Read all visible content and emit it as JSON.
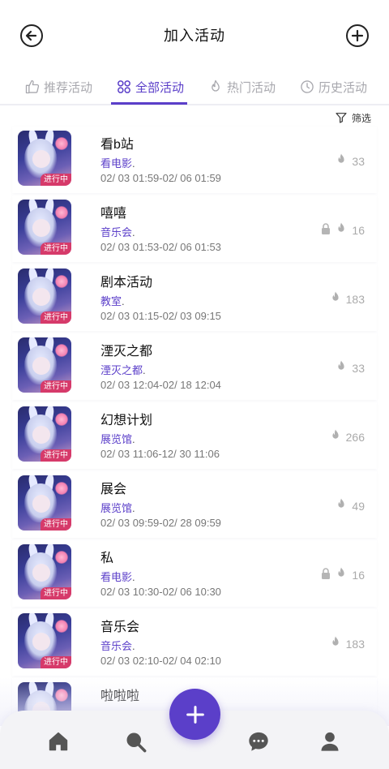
{
  "header": {
    "title": "加入活动"
  },
  "tabs": [
    {
      "label": "推荐活动",
      "icon": "thumb-up-icon"
    },
    {
      "label": "全部活动",
      "icon": "grid-icon",
      "active": true
    },
    {
      "label": "热门活动",
      "icon": "flame-icon"
    },
    {
      "label": "历史活动",
      "icon": "clock-icon"
    }
  ],
  "filter": {
    "label": "筛选"
  },
  "status_badge": "进行中",
  "items": [
    {
      "title": "看b站",
      "type": "看电影",
      "dot": ".",
      "time": "02/ 03  01:59-02/ 06  01:59",
      "count": "33",
      "locked": false
    },
    {
      "title": "嘻嘻",
      "type": "音乐会",
      "dot": ".",
      "time": "02/ 03  01:53-02/ 06  01:53",
      "count": "16",
      "locked": true
    },
    {
      "title": "剧本活动",
      "type": "教室",
      "dot": ".",
      "time": "02/ 03  01:15-02/ 03  09:15",
      "count": "183",
      "locked": false
    },
    {
      "title": "湮灭之都",
      "type": "湮灭之都",
      "dot": ".",
      "time": "02/ 03  12:04-02/ 18  12:04",
      "count": "33",
      "locked": false
    },
    {
      "title": "幻想计划",
      "type": "展览馆",
      "dot": ".",
      "time": "02/ 03  11:06-12/ 30  11:06",
      "count": "266",
      "locked": false
    },
    {
      "title": "展会",
      "type": "展览馆",
      "dot": ".",
      "time": "02/ 03  09:59-02/ 28  09:59",
      "count": "49",
      "locked": false
    },
    {
      "title": "私",
      "type": "看电影",
      "dot": ".",
      "time": "02/ 03  10:30-02/ 06  10:30",
      "count": "16",
      "locked": true
    },
    {
      "title": "音乐会",
      "type": "音乐会",
      "dot": ".",
      "time": "02/ 03  02:10-02/ 04  02:10",
      "count": "183",
      "locked": false
    },
    {
      "title": "啦啦啦",
      "type": "",
      "dot": "",
      "time": "",
      "count": "",
      "locked": false
    }
  ],
  "bottom_nav": [
    "home-icon",
    "search-icon",
    "add-icon",
    "chat-icon",
    "profile-icon"
  ],
  "colors": {
    "accent": "#5b3fc9",
    "badge": "#d63a6a"
  }
}
